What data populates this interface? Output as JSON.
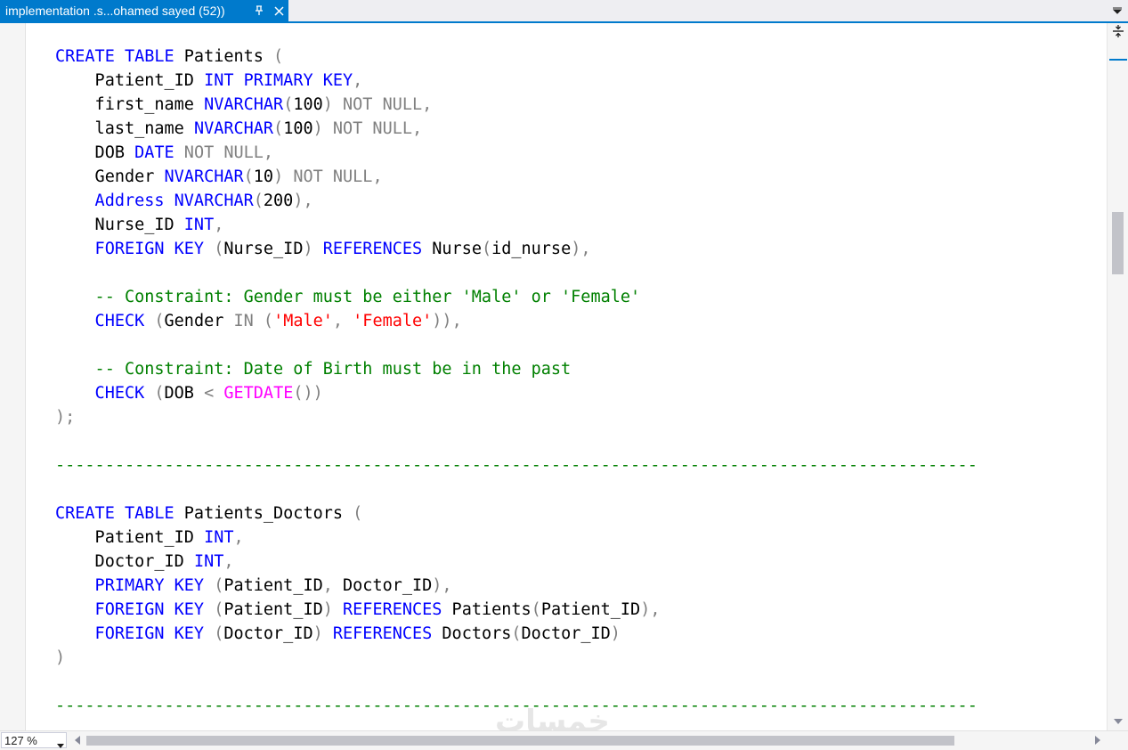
{
  "tab": {
    "title": "implementation .s...ohamed sayed (52))",
    "pin_icon": "pin-icon",
    "close_icon": "close-icon"
  },
  "status": {
    "zoom": "127 %"
  },
  "watermark": "خمسات",
  "colors": {
    "accent": "#007acc",
    "keyword": "#0000ff",
    "operator": "#808080",
    "string": "#ff0000",
    "function": "#ff00ff",
    "comment": "#008000"
  },
  "code_lines": [
    [
      [
        "kw",
        "CREATE TABLE"
      ],
      [
        "plain",
        " Patients "
      ],
      [
        "gray",
        "("
      ]
    ],
    [
      [
        "plain",
        "    Patient_ID "
      ],
      [
        "kw",
        "INT PRIMARY KEY"
      ],
      [
        "gray",
        ","
      ]
    ],
    [
      [
        "plain",
        "    first_name "
      ],
      [
        "kw",
        "NVARCHAR"
      ],
      [
        "gray",
        "("
      ],
      [
        "plain",
        "100"
      ],
      [
        "gray",
        ") NOT NULL,"
      ]
    ],
    [
      [
        "plain",
        "    last_name "
      ],
      [
        "kw",
        "NVARCHAR"
      ],
      [
        "gray",
        "("
      ],
      [
        "plain",
        "100"
      ],
      [
        "gray",
        ") NOT NULL,"
      ]
    ],
    [
      [
        "plain",
        "    DOB "
      ],
      [
        "kw",
        "DATE"
      ],
      [
        "gray",
        " NOT NULL,"
      ]
    ],
    [
      [
        "plain",
        "    Gender "
      ],
      [
        "kw",
        "NVARCHAR"
      ],
      [
        "gray",
        "("
      ],
      [
        "plain",
        "10"
      ],
      [
        "gray",
        ") NOT NULL,"
      ]
    ],
    [
      [
        "kw",
        "    Address NVARCHAR"
      ],
      [
        "gray",
        "("
      ],
      [
        "plain",
        "200"
      ],
      [
        "gray",
        "),"
      ]
    ],
    [
      [
        "plain",
        "    Nurse_ID "
      ],
      [
        "kw",
        "INT"
      ],
      [
        "gray",
        ","
      ]
    ],
    [
      [
        "kw",
        "    FOREIGN KEY "
      ],
      [
        "gray",
        "("
      ],
      [
        "plain",
        "Nurse_ID"
      ],
      [
        "gray",
        ") "
      ],
      [
        "kw",
        "REFERENCES"
      ],
      [
        "plain",
        " Nurse"
      ],
      [
        "gray",
        "("
      ],
      [
        "plain",
        "id_nurse"
      ],
      [
        "gray",
        "),"
      ]
    ],
    [],
    [
      [
        "cm",
        "    -- Constraint: Gender must be either 'Male' or 'Female'"
      ]
    ],
    [
      [
        "kw",
        "    CHECK "
      ],
      [
        "gray",
        "("
      ],
      [
        "plain",
        "Gender "
      ],
      [
        "gray",
        "IN ("
      ],
      [
        "str",
        "'Male'"
      ],
      [
        "gray",
        ", "
      ],
      [
        "str",
        "'Female'"
      ],
      [
        "gray",
        "))"
      ],
      [
        "gray",
        ","
      ]
    ],
    [],
    [
      [
        "cm",
        "    -- Constraint: Date of Birth must be in the past"
      ]
    ],
    [
      [
        "kw",
        "    CHECK "
      ],
      [
        "gray",
        "("
      ],
      [
        "plain",
        "DOB "
      ],
      [
        "gray",
        "< "
      ],
      [
        "fn",
        "GETDATE"
      ],
      [
        "gray",
        "())"
      ]
    ],
    [
      [
        "gray",
        ");"
      ]
    ],
    [],
    [
      [
        "cm",
        "---------------------------------------------------------------------------------------------"
      ]
    ],
    [],
    [
      [
        "kw",
        "CREATE TABLE"
      ],
      [
        "plain",
        " Patients_Doctors "
      ],
      [
        "gray",
        "("
      ]
    ],
    [
      [
        "plain",
        "    Patient_ID "
      ],
      [
        "kw",
        "INT"
      ],
      [
        "gray",
        ","
      ]
    ],
    [
      [
        "plain",
        "    Doctor_ID "
      ],
      [
        "kw",
        "INT"
      ],
      [
        "gray",
        ","
      ]
    ],
    [
      [
        "kw",
        "    PRIMARY KEY "
      ],
      [
        "gray",
        "("
      ],
      [
        "plain",
        "Patient_ID"
      ],
      [
        "gray",
        ", "
      ],
      [
        "plain",
        "Doctor_ID"
      ],
      [
        "gray",
        "),"
      ]
    ],
    [
      [
        "kw",
        "    FOREIGN KEY "
      ],
      [
        "gray",
        "("
      ],
      [
        "plain",
        "Patient_ID"
      ],
      [
        "gray",
        ") "
      ],
      [
        "kw",
        "REFERENCES"
      ],
      [
        "plain",
        " Patients"
      ],
      [
        "gray",
        "("
      ],
      [
        "plain",
        "Patient_ID"
      ],
      [
        "gray",
        "),"
      ]
    ],
    [
      [
        "kw",
        "    FOREIGN KEY "
      ],
      [
        "gray",
        "("
      ],
      [
        "plain",
        "Doctor_ID"
      ],
      [
        "gray",
        ") "
      ],
      [
        "kw",
        "REFERENCES"
      ],
      [
        "plain",
        " Doctors"
      ],
      [
        "gray",
        "("
      ],
      [
        "plain",
        "Doctor_ID"
      ],
      [
        "gray",
        ")"
      ]
    ],
    [
      [
        "gray",
        ")"
      ]
    ],
    [],
    [
      [
        "cm",
        "---------------------------------------------------------------------------------------------"
      ]
    ]
  ]
}
